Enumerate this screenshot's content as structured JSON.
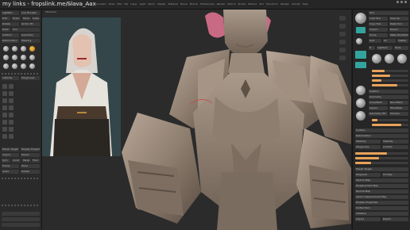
{
  "window": {
    "title": "my links - fropslink.me/Slava_Aax",
    "menu": [
      "Alpha",
      "Brush",
      "Color",
      "Document",
      "Draw",
      "Edit",
      "File",
      "Layer",
      "Light",
      "Macro",
      "Marker",
      "Material",
      "Movie",
      "Picture",
      "Preferences",
      "Render",
      "Stencil",
      "Stroke",
      "Texture",
      "Tool",
      "Transform",
      "Zplugin",
      "Zscript",
      "Help"
    ]
  },
  "left_panel": {
    "labels": [
      "LightBox",
      "Live Boolean",
      "Edit",
      "Draw",
      "Move",
      "Scale",
      "Rotate",
      "Gizmo 3D",
      "PolyF",
      "Tool",
      "SubTool",
      "Geometry",
      "Deformation",
      "Masking",
      "Visibility",
      "Polygroups",
      "Morph Target",
      "Display Properties",
      "Import",
      "Export",
      "Sym",
      "Local",
      "Persp",
      "Floor",
      "Frame",
      "Move",
      "Scale",
      "Rotate"
    ]
  },
  "viewport": {
    "label": "ZModeler"
  },
  "right_panel": {
    "labels": [
      "Tool",
      "Load Tool",
      "Save As",
      "Copy Tool",
      "Paste Tool",
      "Import",
      "Export",
      "Clone",
      "Make PolyMesh3D",
      "GoZ",
      "All",
      "Visible",
      "R",
      "Lightbox",
      "Tools",
      "SubTool",
      "Geometry",
      "ArrayMesh",
      "NanoMesh",
      "Layers",
      "FiberMesh",
      "Geometry HD",
      "Preview",
      "Surface",
      "Deformation",
      "Masking",
      "Visibility",
      "Polygroups",
      "Contact",
      "Morph Target",
      "Polypaint",
      "UV Map",
      "Texture Map",
      "Displacement Map",
      "Normal Map",
      "Vector Displacement Map",
      "Display Properties",
      "Unified Skin",
      "Initialize",
      "Import",
      "Export"
    ],
    "sliders": [
      {
        "label": "Draw Size",
        "value": 0.35
      },
      {
        "label": "Focal Shift",
        "value": 0.5
      },
      {
        "label": "Z Intensity",
        "value": 0.25
      },
      {
        "label": "RGB Intensity",
        "value": 0.7
      },
      {
        "label": "Dynamic",
        "value": 0.15
      },
      {
        "label": "SDiv",
        "value": 0.8
      },
      {
        "label": "Smt",
        "value": 0.6
      },
      {
        "label": "Suv",
        "value": 0.45
      },
      {
        "label": "ReUV",
        "value": 0.3
      }
    ]
  }
}
